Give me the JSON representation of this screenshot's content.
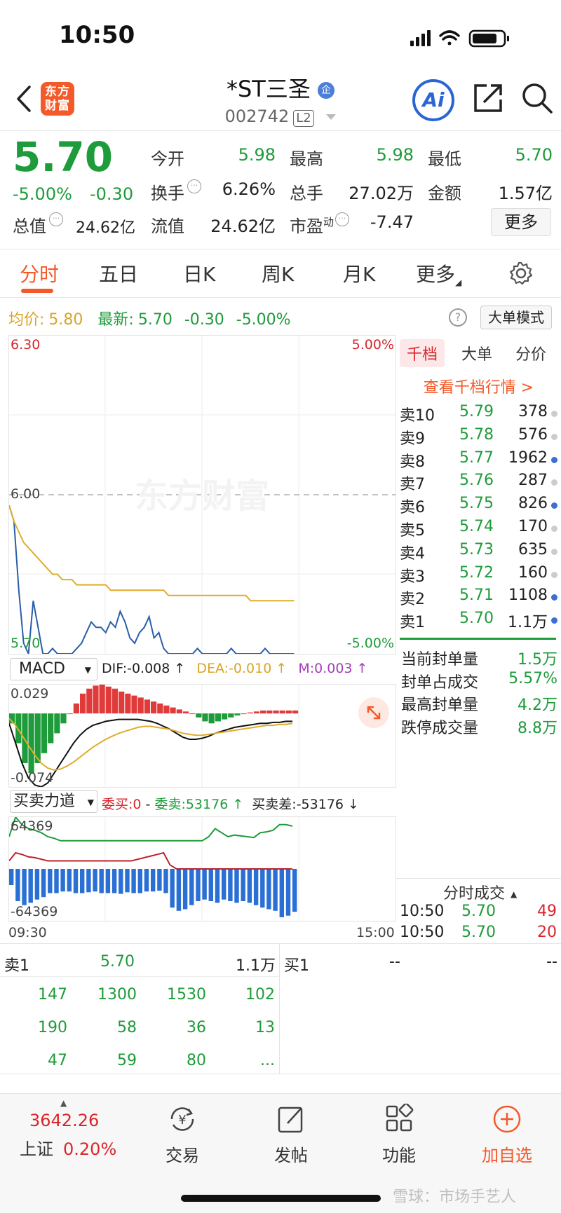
{
  "status_bar": {
    "time": "10:50"
  },
  "header": {
    "logo_text": "东方财富",
    "title": "*ST三圣",
    "badge": "企",
    "code": "002742",
    "level": "L2",
    "ai_label": "Ai"
  },
  "quote": {
    "price": "5.70",
    "change_pct": "-5.00%",
    "change": "-0.30",
    "open_label": "今开",
    "open": "5.98",
    "high_label": "最高",
    "high": "5.98",
    "low_label": "最低",
    "low": "5.70",
    "turnover_label": "换手",
    "turnover": "6.26%",
    "volume_label": "总手",
    "volume": "27.02万",
    "amount_label": "金额",
    "amount": "1.57亿",
    "mktcap_label": "总值",
    "mktcap": "24.62亿",
    "float_label": "流值",
    "float": "24.62亿",
    "pe_label": "市盈",
    "pe_sup": "动",
    "pe": "-7.47",
    "more_label": "更多"
  },
  "tabs": [
    "分时",
    "五日",
    "日K",
    "周K",
    "月K",
    "更多"
  ],
  "info": {
    "avg_label": "均价:",
    "avg": "5.80",
    "latest_label": "最新:",
    "latest": "5.70",
    "latest_change": "-0.30",
    "latest_pct": "-5.00%",
    "help": "?",
    "big_order_mode": "大单模式"
  },
  "chart_data": [
    {
      "type": "line",
      "name_label": "分时",
      "y_max_label": "6.30",
      "y_ref_label": "6.00",
      "y_min_label": "5.70",
      "pct_max_label": "5.00%",
      "pct_min_label": "-5.00%",
      "ylim": [
        5.7,
        6.3
      ],
      "watermark": "东方财富",
      "series": [
        {
          "name": "价格",
          "color": "#2a5ea8",
          "values": [
            5.98,
            5.95,
            5.82,
            5.72,
            5.7,
            5.8,
            5.75,
            5.7,
            5.7,
            5.71,
            5.7,
            5.7,
            5.7,
            5.7,
            5.71,
            5.72,
            5.74,
            5.76,
            5.75,
            5.75,
            5.74,
            5.76,
            5.75,
            5.78,
            5.76,
            5.73,
            5.72,
            5.74,
            5.75,
            5.77,
            5.73,
            5.74,
            5.71,
            5.7,
            5.7,
            5.7,
            5.7,
            5.7,
            5.7,
            5.71,
            5.7,
            5.7,
            5.7,
            5.7,
            5.7,
            5.7,
            5.71,
            5.7,
            5.7,
            5.7,
            5.7,
            5.7,
            5.7,
            5.71,
            5.7,
            5.7,
            5.7,
            5.7,
            5.7,
            5.7
          ]
        },
        {
          "name": "均价",
          "color": "#e0ad2a",
          "values": [
            5.98,
            5.95,
            5.93,
            5.91,
            5.9,
            5.89,
            5.88,
            5.87,
            5.86,
            5.85,
            5.85,
            5.84,
            5.84,
            5.84,
            5.83,
            5.83,
            5.83,
            5.83,
            5.83,
            5.83,
            5.83,
            5.82,
            5.82,
            5.82,
            5.82,
            5.82,
            5.82,
            5.82,
            5.82,
            5.82,
            5.82,
            5.82,
            5.82,
            5.81,
            5.81,
            5.81,
            5.81,
            5.81,
            5.81,
            5.81,
            5.81,
            5.81,
            5.81,
            5.81,
            5.81,
            5.81,
            5.81,
            5.81,
            5.81,
            5.81,
            5.8,
            5.8,
            5.8,
            5.8,
            5.8,
            5.8,
            5.8,
            5.8,
            5.8,
            5.8
          ]
        }
      ],
      "x_start": "09:30",
      "x_end": "15:00"
    },
    {
      "type": "bar",
      "indicator": "MACD",
      "dif_label": "DIF:-0.008 ↑",
      "dea_label": "DEA:-0.010 ↑",
      "m_label": "M:0.003 ↑",
      "y_max_label": "0.029",
      "y_min_label": "-0.074",
      "ylim": [
        -0.074,
        0.029
      ],
      "histogram": [
        -0.01,
        -0.03,
        -0.05,
        -0.06,
        -0.05,
        -0.04,
        -0.03,
        -0.02,
        -0.01,
        0.0,
        0.01,
        0.02,
        0.025,
        0.028,
        0.029,
        0.027,
        0.025,
        0.022,
        0.02,
        0.018,
        0.016,
        0.014,
        0.012,
        0.01,
        0.008,
        0.006,
        0.004,
        0.002,
        0.0,
        -0.004,
        -0.008,
        -0.01,
        -0.008,
        -0.006,
        -0.004,
        -0.002,
        0.0,
        0.001,
        0.002,
        0.003,
        0.003,
        0.003,
        0.003,
        0.003,
        0.003
      ],
      "dif": [
        -0.01,
        -0.03,
        -0.05,
        -0.065,
        -0.072,
        -0.074,
        -0.07,
        -0.06,
        -0.05,
        -0.04,
        -0.03,
        -0.022,
        -0.016,
        -0.012,
        -0.01,
        -0.008,
        -0.007,
        -0.006,
        -0.006,
        -0.006,
        -0.006,
        -0.007,
        -0.008,
        -0.01,
        -0.013,
        -0.016,
        -0.02,
        -0.024,
        -0.026,
        -0.026,
        -0.025,
        -0.023,
        -0.02,
        -0.018,
        -0.016,
        -0.014,
        -0.013,
        -0.012,
        -0.011,
        -0.01,
        -0.01,
        -0.009,
        -0.009,
        -0.008,
        -0.008
      ],
      "dea": [
        -0.005,
        -0.012,
        -0.022,
        -0.032,
        -0.042,
        -0.05,
        -0.055,
        -0.057,
        -0.056,
        -0.053,
        -0.049,
        -0.044,
        -0.039,
        -0.034,
        -0.03,
        -0.026,
        -0.023,
        -0.02,
        -0.018,
        -0.016,
        -0.014,
        -0.013,
        -0.013,
        -0.014,
        -0.015,
        -0.016,
        -0.018,
        -0.02,
        -0.021,
        -0.022,
        -0.022,
        -0.021,
        -0.02,
        -0.019,
        -0.018,
        -0.017,
        -0.016,
        -0.015,
        -0.014,
        -0.013,
        -0.012,
        -0.012,
        -0.011,
        -0.011,
        -0.01
      ]
    },
    {
      "type": "line",
      "indicator": "买卖力道",
      "buy_label": "委买:0",
      "sell_label": "委卖:53176 ↑",
      "diff_label": "买卖差:-53176 ↓",
      "y_max_label": "64369",
      "y_min_label": "-64369",
      "ylim": [
        -64369,
        64369
      ],
      "series": [
        {
          "name": "委卖",
          "color": "#1e9b3a",
          "values": [
            40000,
            64369,
            55000,
            50000,
            48000,
            45000,
            40000,
            38000,
            35000,
            35000,
            35000,
            35000,
            35000,
            35000,
            35000,
            35000,
            35000,
            35000,
            35000,
            35000,
            35000,
            35000,
            35000,
            35000,
            35000,
            35000,
            35000,
            35000,
            35000,
            35000,
            35000,
            40000,
            50000,
            45000,
            40000,
            42000,
            41000,
            40000,
            39000,
            45000,
            46000,
            48000,
            55000,
            55000,
            53176
          ]
        },
        {
          "name": "委买",
          "color": "#c0202a",
          "values": [
            10000,
            20000,
            18000,
            15000,
            14000,
            12000,
            10000,
            10000,
            10000,
            10000,
            10000,
            10000,
            10000,
            10000,
            10000,
            10000,
            10000,
            10000,
            10000,
            10000,
            12000,
            14000,
            16000,
            18000,
            20000,
            5000,
            0,
            0,
            0,
            0,
            0,
            0,
            0,
            0,
            0,
            0,
            0,
            0,
            0,
            0,
            0,
            0,
            0,
            0,
            0
          ]
        },
        {
          "name": "买卖差",
          "color": "#2a6fd4",
          "values": [
            -20000,
            -40000,
            -45000,
            -42000,
            -38000,
            -35000,
            -30000,
            -30000,
            -28000,
            -28000,
            -30000,
            -30000,
            -29000,
            -28000,
            -30000,
            -30000,
            -30000,
            -31000,
            -29000,
            -30000,
            -30000,
            -28000,
            -28000,
            -27000,
            -30000,
            -48000,
            -52000,
            -50000,
            -45000,
            -40000,
            -38000,
            -40000,
            -42000,
            -38000,
            -40000,
            -42000,
            -40000,
            -42000,
            -45000,
            -48000,
            -50000,
            -52000,
            -60000,
            -58000,
            -53176
          ]
        }
      ]
    }
  ],
  "order_book": {
    "tabs": [
      "千档",
      "大单",
      "分价"
    ],
    "link": "查看千档行情 >",
    "asks": [
      {
        "label": "卖10",
        "price": "5.79",
        "vol": "378",
        "dot": "#cccccc"
      },
      {
        "label": "卖9",
        "price": "5.78",
        "vol": "576",
        "dot": "#cccccc"
      },
      {
        "label": "卖8",
        "price": "5.77",
        "vol": "1962",
        "dot": "#3b6fd4"
      },
      {
        "label": "卖7",
        "price": "5.76",
        "vol": "287",
        "dot": "#cccccc"
      },
      {
        "label": "卖6",
        "price": "5.75",
        "vol": "826",
        "dot": "#3b6fd4"
      },
      {
        "label": "卖5",
        "price": "5.74",
        "vol": "170",
        "dot": "#cccccc"
      },
      {
        "label": "卖4",
        "price": "5.73",
        "vol": "635",
        "dot": "#cccccc"
      },
      {
        "label": "卖3",
        "price": "5.72",
        "vol": "160",
        "dot": "#cccccc"
      },
      {
        "label": "卖2",
        "price": "5.71",
        "vol": "1108",
        "dot": "#3b6fd4"
      },
      {
        "label": "卖1",
        "price": "5.70",
        "vol": "1.1万",
        "dot": "#3b6fd4"
      }
    ],
    "stats": [
      {
        "label": "当前封单量",
        "value": "1.5万"
      },
      {
        "label": "封单占成交",
        "value": "5.57%"
      },
      {
        "label": "最高封单量",
        "value": "4.2万"
      },
      {
        "label": "跌停成交量",
        "value": "8.8万"
      }
    ],
    "ticks_title": "分时成交",
    "ticks": [
      {
        "time": "10:50",
        "price": "5.70",
        "vol": "49"
      },
      {
        "time": "10:50",
        "price": "5.70",
        "vol": "20"
      }
    ]
  },
  "bottom_table": {
    "sell1_label": "卖1",
    "sell1_price": "5.70",
    "sell1_vol": "1.1万",
    "buy1_label": "买1",
    "buy1_price": "--",
    "buy1_vol": "--",
    "rows": [
      [
        "147",
        "1300",
        "1530",
        "102"
      ],
      [
        "190",
        "58",
        "36",
        "13"
      ],
      [
        "47",
        "59",
        "80",
        "..."
      ]
    ]
  },
  "bottom_nav": {
    "index_value": "3642.26",
    "index_name": "上证",
    "index_pct": "0.20%",
    "items": [
      {
        "label": "交易",
        "icon": "yen-exchange-icon"
      },
      {
        "label": "发帖",
        "icon": "edit-icon"
      },
      {
        "label": "功能",
        "icon": "grid-icon"
      },
      {
        "label": "加自选",
        "icon": "plus-circle-icon"
      }
    ],
    "watermark": "雪球：市场手艺人"
  }
}
